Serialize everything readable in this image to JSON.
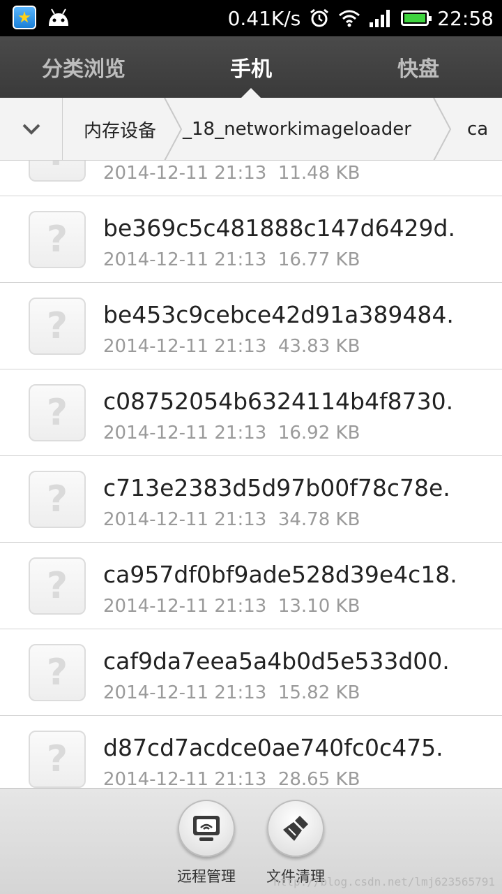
{
  "status_bar": {
    "network_speed": "0.41K/s",
    "time": "22:58",
    "left_icons": [
      "qq-icon",
      "android-icon"
    ],
    "right_icons": [
      "alarm-icon",
      "wifi-icon",
      "signal-icon",
      "battery-icon"
    ]
  },
  "tabs": [
    {
      "label": "分类浏览",
      "active": false
    },
    {
      "label": "手机",
      "active": true
    },
    {
      "label": "快盘",
      "active": false
    }
  ],
  "breadcrumb": {
    "items": [
      "内存设备",
      "_18_networkimageloader",
      "ca"
    ]
  },
  "files": [
    {
      "name": "",
      "date": "2014-12-11 21:13",
      "size": "11.48 KB"
    },
    {
      "name": "be369c5c481888c147d6429d.",
      "date": "2014-12-11 21:13",
      "size": "16.77 KB"
    },
    {
      "name": "be453c9cebce42d91a389484.",
      "date": "2014-12-11 21:13",
      "size": "43.83 KB"
    },
    {
      "name": "c08752054b6324114b4f8730.",
      "date": "2014-12-11 21:13",
      "size": "16.92 KB"
    },
    {
      "name": "c713e2383d5d97b00f78c78e.",
      "date": "2014-12-11 21:13",
      "size": "34.78 KB"
    },
    {
      "name": "ca957df0bf9ade528d39e4c18.",
      "date": "2014-12-11 21:13",
      "size": "13.10 KB"
    },
    {
      "name": "caf9da7eea5a4b0d5e533d00.",
      "date": "2014-12-11 21:13",
      "size": "15.82 KB"
    },
    {
      "name": "d87cd7acdce0ae740fc0c475.",
      "date": "2014-12-11 21:13",
      "size": "28.65 KB"
    }
  ],
  "unknown_file_glyph": "?",
  "bottom_actions": [
    {
      "label": "远程管理",
      "icon": "remote-monitor-icon"
    },
    {
      "label": "文件清理",
      "icon": "broom-icon"
    }
  ],
  "watermark": "http://blog.csdn.net/lmj623565791"
}
